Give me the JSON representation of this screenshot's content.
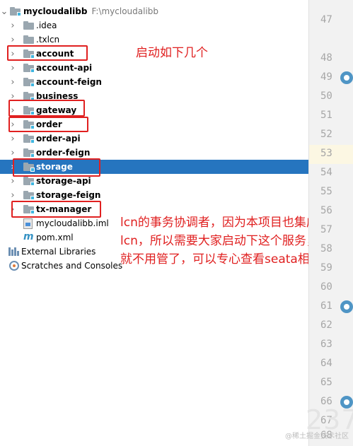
{
  "project": {
    "name": "mycloudalibb",
    "path": "F:\\mycloudalibb"
  },
  "tree": [
    {
      "label": ".idea",
      "bold": false
    },
    {
      "label": ".txlcn",
      "bold": false
    },
    {
      "label": "account",
      "bold": true
    },
    {
      "label": "account-api",
      "bold": true
    },
    {
      "label": "account-feign",
      "bold": true
    },
    {
      "label": "business",
      "bold": true
    },
    {
      "label": "gateway",
      "bold": true
    },
    {
      "label": "order",
      "bold": true
    },
    {
      "label": "order-api",
      "bold": true
    },
    {
      "label": "order-feign",
      "bold": true
    },
    {
      "label": "storage",
      "bold": true
    },
    {
      "label": "storage-api",
      "bold": true
    },
    {
      "label": "storage-feign",
      "bold": true
    },
    {
      "label": "tx-manager",
      "bold": true
    }
  ],
  "files": {
    "iml": "mycloudalibb.iml",
    "pom": "pom.xml"
  },
  "external_libraries": "External Libraries",
  "scratches": "Scratches and Consoles",
  "gutter_lines": [
    "47",
    "48",
    "49",
    "50",
    "51",
    "52",
    "53",
    "54",
    "55",
    "56",
    "57",
    "58",
    "59",
    "60",
    "61",
    "62",
    "63",
    "64",
    "65",
    "66",
    "67",
    "68"
  ],
  "annotations": {
    "top": "启动如下几个",
    "main": "lcn的事务协调者，因为本项目也集成了lcn，所以需要大家启动下这个服务，然后就不用管了，可以专心查看seata相关"
  },
  "watermark": "@稀土掘金技术社区",
  "watermark_big": "237",
  "colors": {
    "selection": "#2675bf",
    "highlight_box": "#e02020",
    "annotation_text": "#e02020",
    "folder": "#9aa7b0",
    "module_badge": "#40b6e0"
  }
}
